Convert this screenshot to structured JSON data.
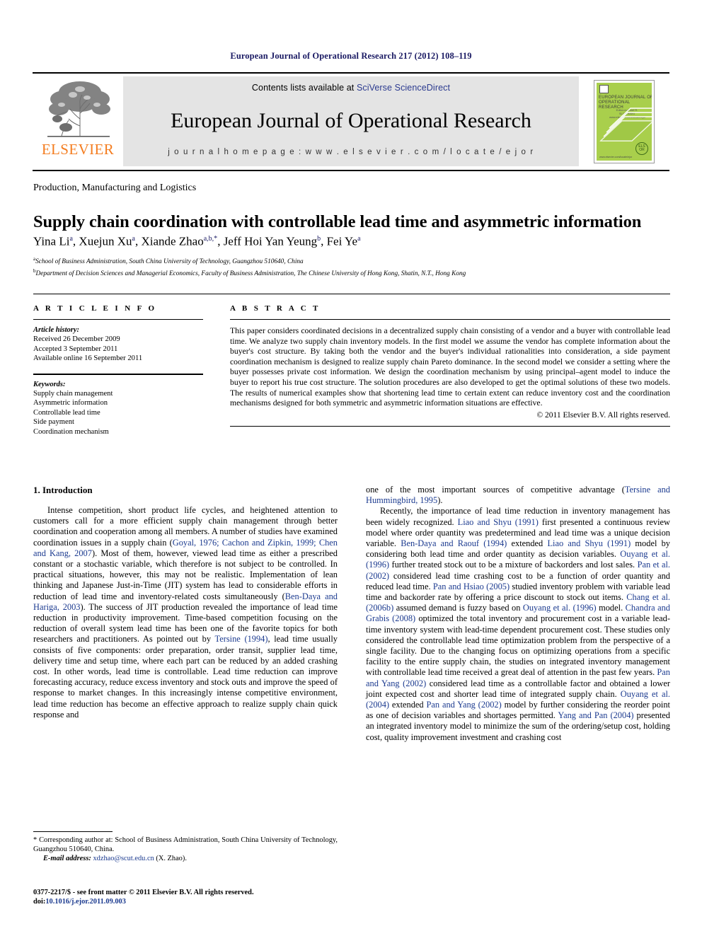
{
  "running_head": "European Journal of Operational Research 217 (2012) 108–119",
  "masthead": {
    "publisher_wordmark": "ELSEVIER",
    "contents_prefix": "Contents lists available at ",
    "contents_link": "SciVerse ScienceDirect",
    "journal_name": "European Journal of Operational Research",
    "homepage_label": "j o u r n a l   h o m e p a g e :   w w w . e l s e v i e r . c o m / l o c a t e / e j o r",
    "cover": {
      "title": "EUROPEAN JOURNAL OF OPERATIONAL RESEARCH",
      "subtitle": "Editor-in-Chief\nR. SLOWINSKI\nwww.elsevier.com/locate/ejor",
      "footer": "www.elsevier.com/locate/ejor",
      "mark": "ELS OR"
    }
  },
  "section_label": "Production, Manufacturing and Logistics",
  "title": "Supply chain coordination with controllable lead time and asymmetric information",
  "authors": [
    {
      "name": "Yina Li",
      "sup": "a"
    },
    {
      "name": "Xuejun Xu",
      "sup": "a"
    },
    {
      "name": "Xiande Zhao",
      "sup": "a,b,*"
    },
    {
      "name": "Jeff Hoi Yan Yeung",
      "sup": "b"
    },
    {
      "name": "Fei Ye",
      "sup": "a"
    }
  ],
  "affiliations": [
    {
      "mark": "a",
      "text": "School of Business Administration, South China University of Technology, Guangzhou 510640, China"
    },
    {
      "mark": "b",
      "text": "Department of Decision Sciences and Managerial Economics, Faculty of Business Administration, The Chinese University of Hong Kong, Shatin, N.T., Hong Kong"
    }
  ],
  "article_info": {
    "heading": "A R T I C L E   I N F O",
    "history_label": "Article history:",
    "history": [
      "Received 26 December 2009",
      "Accepted 3 September 2011",
      "Available online 16 September 2011"
    ],
    "keywords_label": "Keywords:",
    "keywords": [
      "Supply chain management",
      "Asymmetric information",
      "Controllable lead time",
      "Side payment",
      "Coordination mechanism"
    ]
  },
  "abstract": {
    "heading": "A B S T R A C T",
    "text": "This paper considers coordinated decisions in a decentralized supply chain consisting of a vendor and a buyer with controllable lead time. We analyze two supply chain inventory models. In the first model we assume the vendor has complete information about the buyer's cost structure. By taking both the vendor and the buyer's individual rationalities into consideration, a side payment coordination mechanism is designed to realize supply chain Pareto dominance. In the second model we consider a setting where the buyer possesses private cost information. We design the coordination mechanism by using principal–agent model to induce the buyer to report his true cost structure. The solution procedures are also developed to get the optimal solutions of these two models. The results of numerical examples show that shortening lead time to certain extent can reduce inventory cost and the coordination mechanisms designed for both symmetric and asymmetric information situations are effective.",
    "copyright": "© 2011 Elsevier B.V. All rights reserved."
  },
  "introduction": {
    "heading": "1. Introduction",
    "left_paragraph_1_a": "Intense competition, short product life cycles, and heightened attention to customers call for a more efficient supply chain management through better coordination and cooperation among all members. A number of studies have examined coordination issues in a supply chain (",
    "left_ref_1": "Goyal, 1976; Cachon and Zipkin, 1999; Chen and Kang, 2007",
    "left_paragraph_1_b": "). Most of them, however, viewed lead time as either a prescribed constant or a stochastic variable, which therefore is not subject to be controlled. In practical situations, however, this may not be realistic. Implementation of lean thinking and Japanese Just-in-Time (JIT) system has lead to considerable efforts in reduction of lead time and inventory-related costs simultaneously (",
    "left_ref_2": "Ben-Daya and Hariga, 2003",
    "left_paragraph_1_c": "). The success of JIT production revealed the importance of lead time reduction in productivity improvement. Time-based competition focusing on the reduction of overall system lead time has been one of the favorite topics for both researchers and practitioners. As pointed out by ",
    "left_ref_3": "Tersine (1994)",
    "left_paragraph_1_d": ", lead time usually consists of five components: order preparation, order transit, supplier lead time, delivery time and setup time, where each part can be reduced by an added crashing cost. In other words, lead time is controllable. Lead time reduction can improve forecasting accuracy, reduce excess inventory and stock outs and improve the speed of response to market changes. In this increasingly intense competitive environment, lead time reduction has become an effective approach to realize supply chain quick response and ",
    "right_paragraph_1_a": "one of the most important sources of competitive advantage (",
    "right_ref_0": "Tersine and Hummingbird, 1995",
    "right_paragraph_1_b": ").",
    "right_paragraph_2_a": "Recently, the importance of lead time reduction in inventory management has been widely recognized. ",
    "right_ref_1": "Liao and Shyu (1991)",
    "right_paragraph_2_b": " first presented a continuous review model where order quantity was predetermined and lead time was a unique decision variable. ",
    "right_ref_2": "Ben-Daya and Raouf (1994)",
    "right_paragraph_2_c": " extended ",
    "right_ref_3": "Liao and Shyu (1991)",
    "right_paragraph_2_d": " model by considering both lead time and order quantity as decision variables. ",
    "right_ref_4": "Ouyang et al. (1996)",
    "right_paragraph_2_e": " further treated stock out to be a mixture of backorders and lost sales. ",
    "right_ref_5": "Pan et al. (2002)",
    "right_paragraph_2_f": " considered lead time crashing cost to be a function of order quantity and reduced lead time. ",
    "right_ref_6": "Pan and Hsiao (2005)",
    "right_paragraph_2_g": " studied inventory problem with variable lead time and backorder rate by offering a price discount to stock out items. ",
    "right_ref_7": "Chang et al. (2006b)",
    "right_paragraph_2_h": " assumed demand is fuzzy based on ",
    "right_ref_8": "Ouyang et al. (1996)",
    "right_paragraph_2_i": " model. ",
    "right_ref_9": "Chandra and Grabis (2008)",
    "right_paragraph_2_j": " optimized the total inventory and procurement cost in a variable lead-time inventory system with lead-time dependent procurement cost. These studies only considered the controllable lead time optimization problem from the perspective of a single facility. Due to the changing focus on optimizing operations from a specific facility to the entire supply chain, the studies on integrated inventory management with controllable lead time received a great deal of attention in the past few years. ",
    "right_ref_10": "Pan and Yang (2002)",
    "right_paragraph_2_k": " considered lead time as a controllable factor and obtained a lower joint expected cost and shorter lead time of integrated supply chain. ",
    "right_ref_11": "Ouyang et al. (2004)",
    "right_paragraph_2_l": " extended ",
    "right_ref_12": "Pan and Yang (2002)",
    "right_paragraph_2_m": " model by further considering the reorder point as one of decision variables and shortages permitted. ",
    "right_ref_13": "Yang and Pan (2004)",
    "right_paragraph_2_n": " presented an integrated inventory model to minimize the sum of the ordering/setup cost, holding cost, quality improvement investment and crashing cost"
  },
  "footnote": {
    "corresponding_mark": "*",
    "corresponding_text": "Corresponding author at: School of Business Administration, South China University of Technology, Guangzhou 510640, China.",
    "email_label": "E-mail address:",
    "email": "xdzhao@scut.edu.cn",
    "email_suffix": "(X. Zhao)."
  },
  "imprint": {
    "issn_line": "0377-2217/$ - see front matter © 2011 Elsevier B.V. All rights reserved.",
    "doi_label": "doi:",
    "doi": "10.1016/j.ejor.2011.09.003"
  },
  "colors": {
    "link_blue": "#1b3a8f",
    "head_navy": "#1b1b64",
    "elsevier_orange": "#f47d20",
    "banner_gray": "#e4e4e4",
    "cover_green": "#a9cf4c"
  }
}
